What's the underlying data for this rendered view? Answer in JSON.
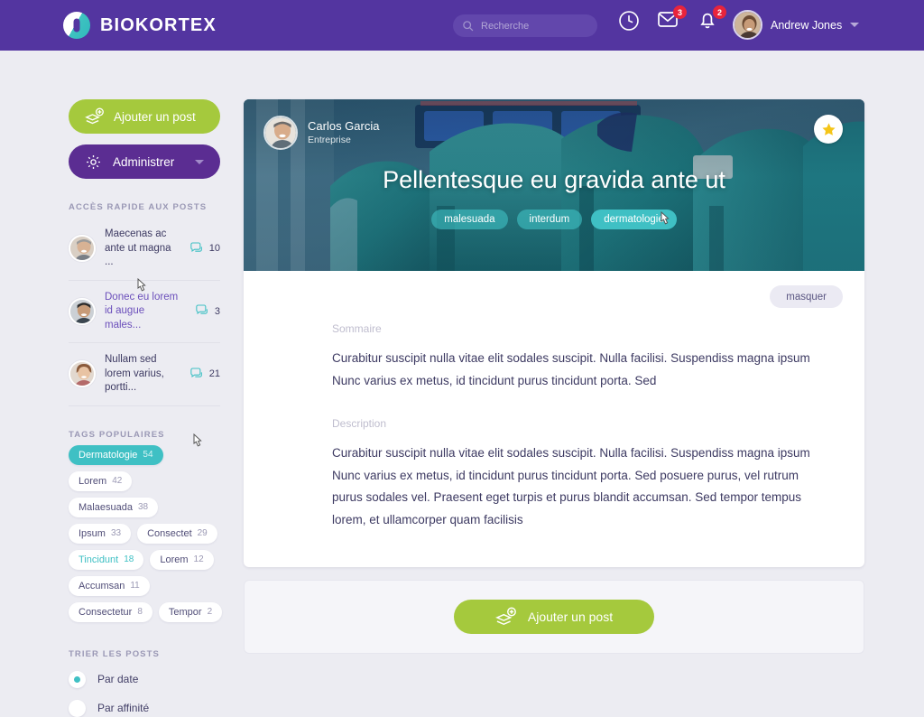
{
  "header": {
    "brand": "BIOKORTEX",
    "logo_icon": "biokortex-circle-logo",
    "search": {
      "placeholder": "Recherche",
      "value": "",
      "icon": "search-icon"
    },
    "icons": [
      {
        "name": "clock-icon",
        "badge": ""
      },
      {
        "name": "envelope-icon",
        "badge": "3"
      },
      {
        "name": "bell-icon",
        "badge": "2"
      }
    ],
    "user": {
      "name": "Andrew Jones",
      "avatar": "user-avatar",
      "caret": "chevron-down-icon"
    },
    "colors": {
      "bar": "#5335A0",
      "search_bg": "#6247AC",
      "badge": "#E8243C"
    }
  },
  "sidebar": {
    "add_post_label": "Ajouter un post",
    "add_post_icon": "layers-plus-icon",
    "admin_label": "Administrer",
    "admin_icon": "gear-icon",
    "quick_access_title": "ACCÈS RAPIDE AUX POSTS",
    "quick_access": [
      {
        "text": "Maecenas ac ante ut magna ...",
        "count": "10",
        "hovered": false
      },
      {
        "text": "Donec eu lorem id augue males...",
        "count": "3",
        "hovered": true
      },
      {
        "text": "Nullam sed lorem varius, portti...",
        "count": "21",
        "hovered": false
      }
    ],
    "tags_title": "TAGS POPULAIRES",
    "tags": [
      {
        "label": "Dermatologie",
        "count": "54",
        "state": "active"
      },
      {
        "label": "Lorem",
        "count": "42",
        "state": "normal"
      },
      {
        "label": "Malaesuada",
        "count": "38",
        "state": "normal"
      },
      {
        "label": "Ipsum",
        "count": "33",
        "state": "normal"
      },
      {
        "label": "Consectet",
        "count": "29",
        "state": "normal"
      },
      {
        "label": "Tincidunt",
        "count": "18",
        "state": "hover"
      },
      {
        "label": "Lorem",
        "count": "12",
        "state": "normal"
      },
      {
        "label": "Accumsan",
        "count": "11",
        "state": "normal"
      },
      {
        "label": "Consectetur",
        "count": "8",
        "state": "normal"
      },
      {
        "label": "Tempor",
        "count": "2",
        "state": "normal"
      }
    ],
    "sort_title": "TRIER LES POSTS",
    "sort_options": [
      {
        "label": "Par date",
        "selected": true
      },
      {
        "label": "Par affinité",
        "selected": false
      }
    ],
    "colors": {
      "green": "#A5C93D",
      "purple": "#5B2D92",
      "teal": "#3FC0C4"
    }
  },
  "post": {
    "author_name": "Carlos Garcia",
    "author_role": "Entreprise",
    "star_icon": "star-icon",
    "title": "Pellentesque eu gravida ante ut",
    "tags": [
      {
        "label": "malesuada",
        "strong": false
      },
      {
        "label": "interdum",
        "strong": false
      },
      {
        "label": "dermatologie",
        "strong": true
      }
    ],
    "hide_label": "masquer",
    "summary_label": "Sommaire",
    "summary_text": "Curabitur suscipit nulla vitae elit sodales suscipit. Nulla facilisi. Suspendiss magna ipsum Nunc varius ex metus, id tincidunt purus tincidunt porta. Sed",
    "description_label": "Description",
    "description_text": "Curabitur suscipit nulla vitae elit sodales suscipit. Nulla facilisi. Suspendiss magna ipsum Nunc varius ex metus, id tincidunt purus tincidunt porta. Sed posuere purus, vel rutrum purus sodales vel. Praesent eget turpis et purus blandit accumsan. Sed tempor tempus lorem, et ullamcorper quam facilisis"
  },
  "footer": {
    "add_post_label": "Ajouter un post",
    "add_post_icon": "layers-plus-icon"
  }
}
